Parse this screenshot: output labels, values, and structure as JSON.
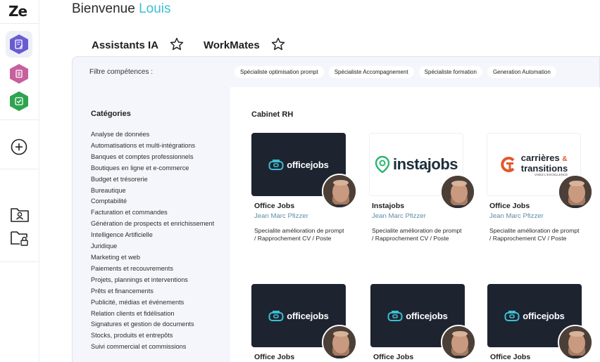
{
  "app": {
    "logo": "Ze"
  },
  "header": {
    "greeting": "Bienvenue",
    "user_name": "Louis"
  },
  "tabs": [
    {
      "label": "Assistants IA"
    },
    {
      "label": "WorkMates"
    }
  ],
  "filters": {
    "label": "Filtre compétences :",
    "chips": [
      "Spécialiste optimisation prompt",
      "Spécialiste Accompagnement",
      "Spécialiste formation",
      "Generation Automation"
    ]
  },
  "categories": {
    "title": "Catégories",
    "items": [
      "Analyse de données",
      "Automatisations et multi-intégrations",
      "Banques et comptes professionnels",
      "Boutiques en ligne et e-commerce",
      "Budget et trésorerie",
      "Bureautique",
      "Comptabilité",
      "Facturation et commandes",
      "Génération de prospects et enrichissement",
      "Intelligence Artificielle",
      "Juridique",
      "Marketing et web",
      "Paiements et recouvrements",
      "Projets, plannings et interventions",
      "Prêts et financements",
      "Publicité, médias et événements",
      "Relation clients et fidélisation",
      "Signatures et gestion de documents",
      "Stocks, produits et entrepôts",
      "Suivi commercial et commissions"
    ]
  },
  "main": {
    "section_title": "Cabinet RH",
    "cards": [
      {
        "name": "Office Jobs",
        "author": "Jean Marc Pfizzer",
        "description": "Specialite amélioration de prompt / Rapprochement CV / Poste",
        "logo": {
          "kind": "officejobs",
          "text": "officejobs"
        }
      },
      {
        "name": "Instajobs",
        "author": "Jean Marc Pfizzer",
        "description": "Specialite amélioration de prompt / Rapprochement CV / Poste",
        "logo": {
          "kind": "instajobs",
          "text": "instajobs"
        }
      },
      {
        "name": "Office Jobs",
        "author": "Jean Marc Pfizzer",
        "description": "Specialite amélioration de prompt / Rapprochement CV / Poste",
        "logo": {
          "kind": "carrieres",
          "line1": "carrières",
          "amp": "&",
          "line2": "transitions",
          "tagline": "VISEZ L'EXCELLENCE"
        }
      },
      {
        "name": "Office Jobs",
        "author": "",
        "description": "",
        "logo": {
          "kind": "officejobs",
          "text": "officejobs"
        }
      },
      {
        "name": "Office Jobs",
        "author": "",
        "description": "",
        "logo": {
          "kind": "officejobs",
          "text": "officejobs"
        }
      },
      {
        "name": "Office Jobs",
        "author": "",
        "description": "",
        "logo": {
          "kind": "officejobs",
          "text": "officejobs"
        }
      }
    ]
  },
  "colors": {
    "accent": "#3cbfd3",
    "author": "#5d8ea8",
    "card_dark": "#1d2430",
    "panel_bg": "#f5f6fb"
  },
  "icons": {
    "rail": [
      "document-edit-icon",
      "stack-document-icon",
      "check-document-icon",
      "add-circle-icon",
      "user-folder-icon",
      "lock-folder-icon"
    ],
    "tab_star": "star-outline-icon"
  }
}
